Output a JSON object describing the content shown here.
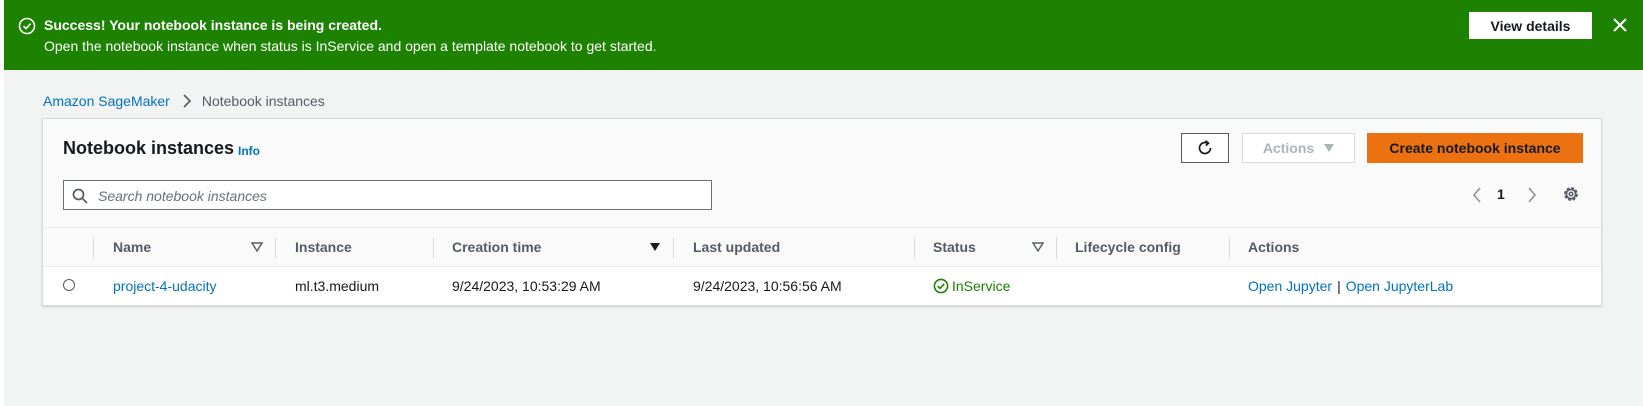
{
  "flash": {
    "title": "Success! Your notebook instance is being created.",
    "message": "Open the notebook instance when status is InService and open a template notebook to get started.",
    "view_details_label": "View details",
    "icon": "check-circle-icon",
    "close_icon": "close-icon",
    "color": "#1d8102"
  },
  "breadcrumb": {
    "root": "Amazon SageMaker",
    "current": "Notebook instances"
  },
  "panel": {
    "title": "Notebook instances",
    "info_label": "Info",
    "actions_label": "Actions",
    "create_label": "Create notebook instance",
    "accent_color": "#ec7211"
  },
  "search": {
    "placeholder": "Search notebook instances",
    "value": ""
  },
  "pagination": {
    "page": "1"
  },
  "table": {
    "columns": [
      "Name",
      "Instance",
      "Creation time",
      "Last updated",
      "Status",
      "Lifecycle config",
      "Actions"
    ],
    "rows": [
      {
        "name": "project-4-udacity",
        "instance": "ml.t3.medium",
        "creation_time": "9/24/2023, 10:53:29 AM",
        "last_updated": "9/24/2023, 10:56:56 AM",
        "status": "InService",
        "lifecycle_config": "",
        "action_jupyter": "Open Jupyter",
        "action_separator": "|",
        "action_jupyterlab": "Open JupyterLab"
      }
    ]
  }
}
